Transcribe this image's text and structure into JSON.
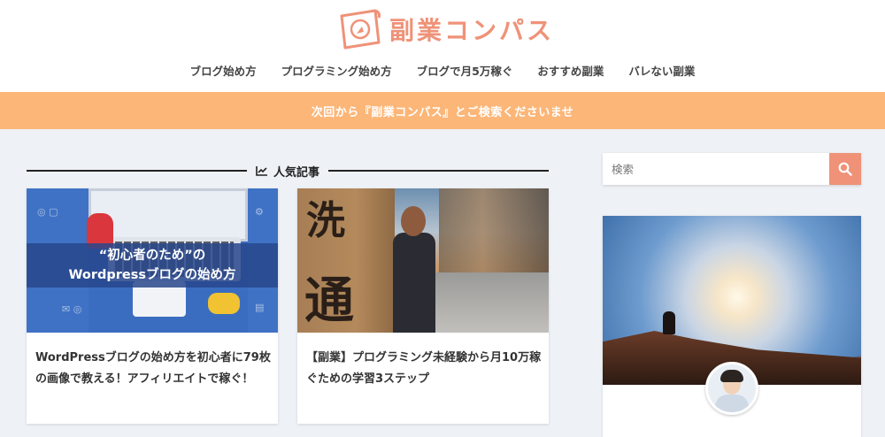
{
  "site": {
    "name": "副業コンパス",
    "brand_color": "#ef9278"
  },
  "nav": {
    "items": [
      {
        "label": "ブログ始め方"
      },
      {
        "label": "プログラミング始め方"
      },
      {
        "label": "ブログで月5万稼ぐ"
      },
      {
        "label": "おすすめ副業"
      },
      {
        "label": "バレない副業"
      }
    ]
  },
  "banner": {
    "text": "次回から『副業コンパス』とご検索くださいませ",
    "color": "#fcb678"
  },
  "popular": {
    "heading": "人気記事",
    "icon": "trending-chart-icon",
    "cards": [
      {
        "thumb_line1": "“初心者のため”の",
        "thumb_line2": "Wordpressブログの始め方",
        "title": "WordPressブログの始め方を初心者に79枚の画像で教える！アフィリエイトで稼ぐ！"
      },
      {
        "thumb_kanji1": "洗",
        "thumb_kanji2": "通",
        "title": "【副業】プログラミング未経験から月10万稼ぐための学習3ステップ"
      }
    ]
  },
  "sidebar": {
    "search": {
      "placeholder": "検索",
      "button_icon": "search-icon"
    }
  }
}
